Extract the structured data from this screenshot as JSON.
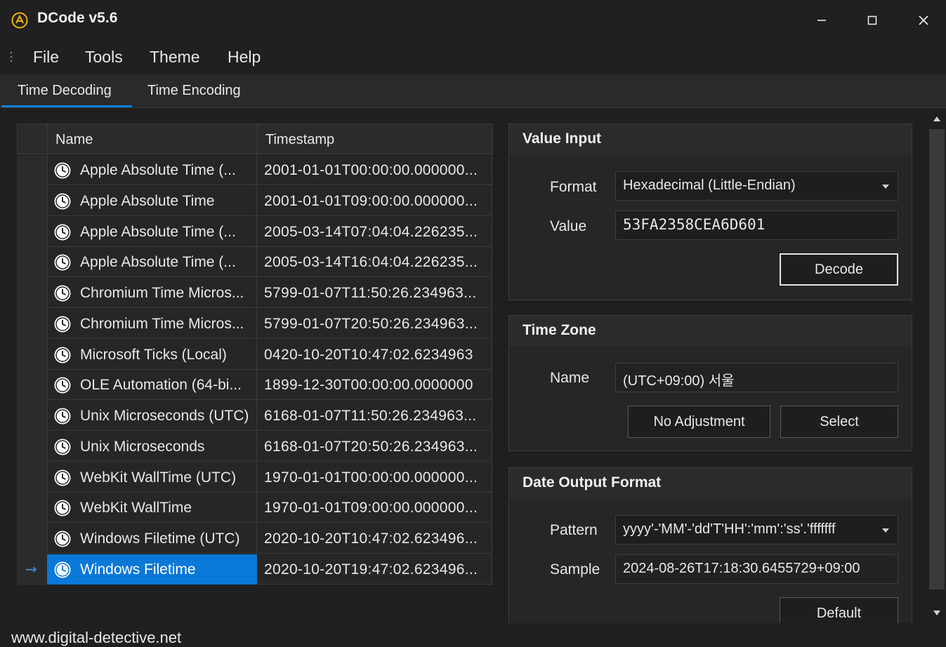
{
  "window": {
    "title": "DCode v5.6",
    "controls": {
      "minimize": "—",
      "maximize": "☐",
      "close": "✕"
    }
  },
  "menu": [
    "File",
    "Tools",
    "Theme",
    "Help"
  ],
  "tabs": [
    {
      "label": "Time Decoding",
      "active": true
    },
    {
      "label": "Time Encoding",
      "active": false
    }
  ],
  "grid": {
    "columns": {
      "name": "Name",
      "timestamp": "Timestamp"
    },
    "rows": [
      {
        "name": "Apple Absolute Time (...",
        "timestamp": "2001-01-01T00:00:00.000000..."
      },
      {
        "name": "Apple Absolute Time",
        "timestamp": "2001-01-01T09:00:00.000000..."
      },
      {
        "name": "Apple Absolute Time (...",
        "timestamp": "2005-03-14T07:04:04.226235..."
      },
      {
        "name": "Apple Absolute Time (...",
        "timestamp": "2005-03-14T16:04:04.226235..."
      },
      {
        "name": "Chromium Time Micros...",
        "timestamp": "5799-01-07T11:50:26.234963..."
      },
      {
        "name": "Chromium Time Micros...",
        "timestamp": "5799-01-07T20:50:26.234963..."
      },
      {
        "name": "Microsoft Ticks (Local)",
        "timestamp": "0420-10-20T10:47:02.6234963"
      },
      {
        "name": "OLE Automation (64-bi...",
        "timestamp": "1899-12-30T00:00:00.0000000"
      },
      {
        "name": "Unix Microseconds (UTC)",
        "timestamp": "6168-01-07T11:50:26.234963..."
      },
      {
        "name": "Unix Microseconds",
        "timestamp": "6168-01-07T20:50:26.234963..."
      },
      {
        "name": "WebKit WallTime (UTC)",
        "timestamp": "1970-01-01T00:00:00.000000..."
      },
      {
        "name": "WebKit WallTime",
        "timestamp": "1970-01-01T09:00:00.000000..."
      },
      {
        "name": "Windows Filetime (UTC)",
        "timestamp": "2020-10-20T10:47:02.623496..."
      },
      {
        "name": "Windows Filetime",
        "timestamp": "2020-10-20T19:47:02.623496...",
        "selected": true
      }
    ],
    "current_row_marker": "→"
  },
  "value_input": {
    "title": "Value Input",
    "format_label": "Format",
    "format_value": "Hexadecimal (Little-Endian)",
    "value_label": "Value",
    "value_value": "53FA2358CEA6D601",
    "decode_button": "Decode"
  },
  "time_zone": {
    "title": "Time Zone",
    "name_label": "Name",
    "name_value": "(UTC+09:00) 서울",
    "no_adjustment_button": "No Adjustment",
    "select_button": "Select"
  },
  "date_output": {
    "title": "Date Output Format",
    "pattern_label": "Pattern",
    "pattern_value": "yyyy'-'MM'-'dd'T'HH':'mm':'ss'.'fffffff",
    "sample_label": "Sample",
    "sample_value": "2024-08-26T17:18:30.6455729+09:00",
    "default_button": "Default"
  },
  "status": {
    "url": "www.digital-detective.net"
  },
  "colors": {
    "accent": "#0a78d7",
    "background": "#202020",
    "panel": "#262626"
  }
}
